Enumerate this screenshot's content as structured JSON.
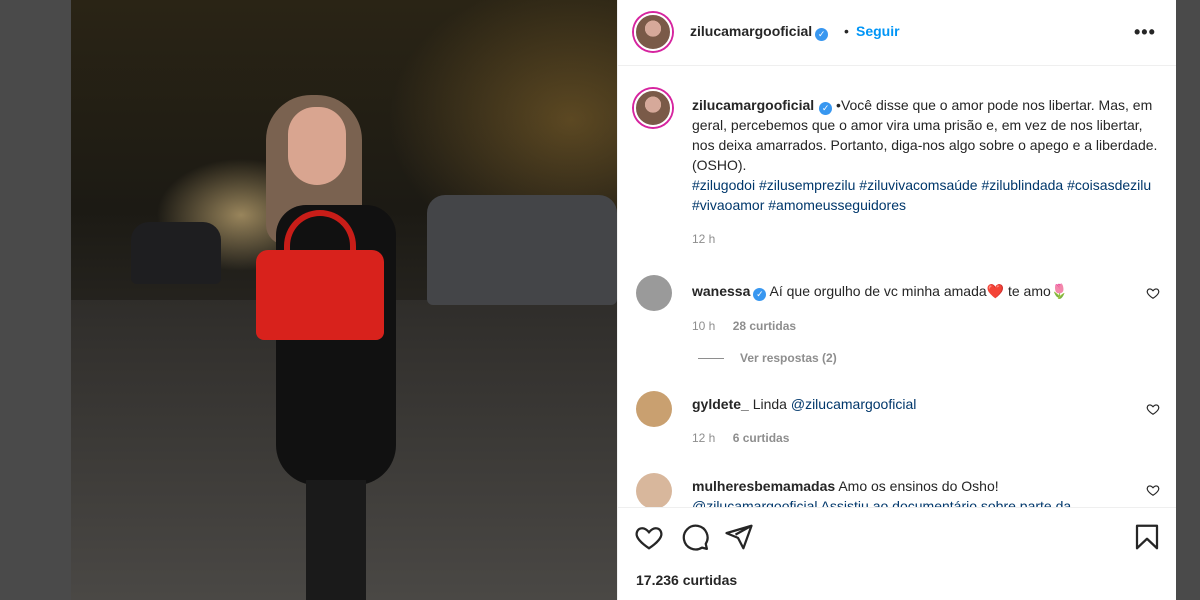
{
  "post": {
    "username": "zilucamargooficial",
    "follow_label": "Seguir",
    "dot": "•",
    "more": "•••"
  },
  "caption": {
    "username": "zilucamargooficial",
    "text": "•Você disse que o amor pode nos libertar. Mas, em geral, percebemos que o amor vira uma prisão e, em vez de nos libertar, nos deixa amarrados. Portanto, diga-nos algo sobre o apego e a liberdade. (OSHO).",
    "hashtags": "#zilugodoi #zilusemprezilu #ziluvivacomsaúde #zilublindada #coisasdezilu #vivaoamor #amomeusseguidores",
    "time": "12 h"
  },
  "comments": [
    {
      "username": "wanessa",
      "text": "Aí que orgulho de vc minha amada",
      "text_after": " te amo",
      "emoji1": "❤️",
      "emoji2": "🌷",
      "time": "10 h",
      "likes": "28 curtidas",
      "avatar_color": "#9a9a9a"
    },
    {
      "username": "gyldete_",
      "text": "Linda ",
      "mention": "@zilucamargooficial",
      "time": "12 h",
      "likes": "6 curtidas",
      "avatar_color": "#c9a070"
    },
    {
      "username": "mulheresbemamadas",
      "text": "Amo os ensinos do Osho!",
      "line2": "@zilucamargooficial Assistiu ao documentário sobre parte da",
      "avatar_color": "#d8b79c"
    }
  ],
  "view_replies": "Ver respostas (2)",
  "likes_total": "17.236 curtidas",
  "icons": {
    "like": "heart-icon",
    "comment": "comment-icon",
    "share": "share-icon",
    "save": "bookmark-icon"
  },
  "colors": {
    "link": "#0095f6",
    "hashtag": "#00376b",
    "muted": "#8e8e8e",
    "text": "#262626"
  }
}
